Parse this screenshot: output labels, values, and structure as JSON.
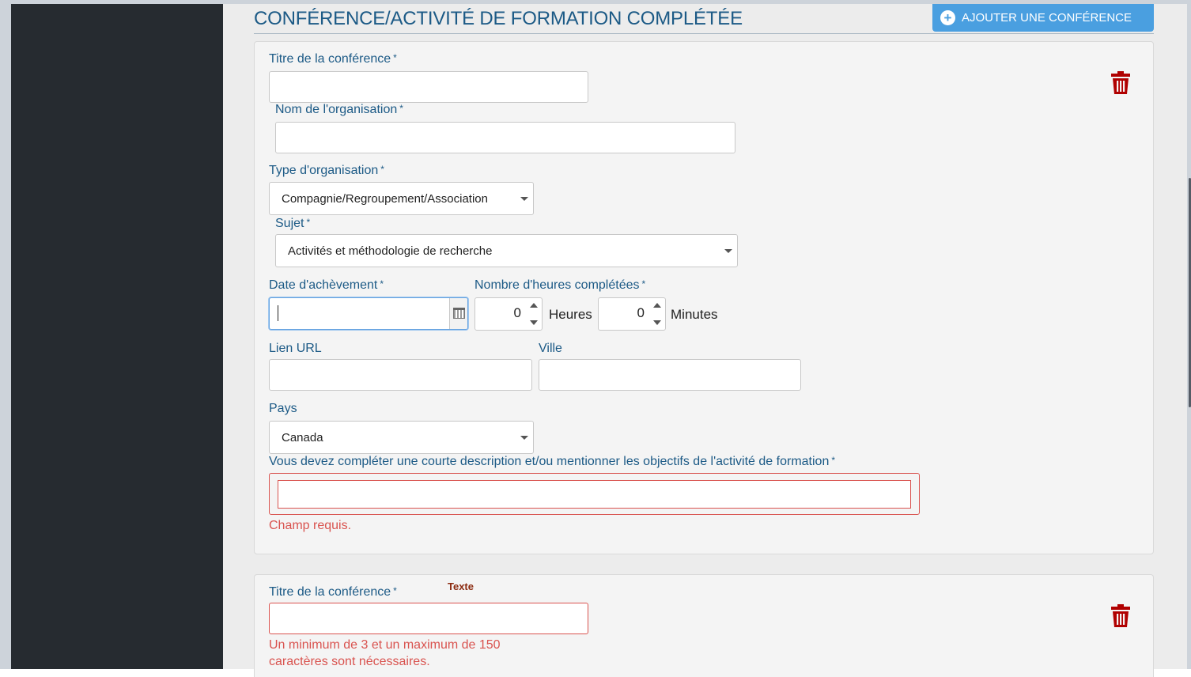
{
  "header": {
    "section_title": "CONFÉRENCE/ACTIVITÉ DE FORMATION COMPLÉTÉE",
    "add_button_label": "AJOUTER UNE CONFÉRENCE",
    "add_icon": "plus-circle-icon"
  },
  "colors": {
    "label_blue": "#1c5a86",
    "button_blue": "#4a9fe0",
    "sidebar": "#262b30",
    "error_red": "#d9534f",
    "trash_red": "#b00000"
  },
  "required_mark": "*",
  "form1": {
    "conference_title_label": "Titre de la conférence",
    "conference_title_value": "",
    "organization_name_label": "Nom de l'organisation",
    "organization_name_value": "",
    "organization_type_label": "Type d'organisation",
    "organization_type_value": "Compagnie/Regroupement/Association",
    "subject_label": "Sujet",
    "subject_value": "Activités et méthodologie de recherche",
    "completion_date_label": "Date d'achèvement",
    "completion_date_value": "",
    "hours_completed_label": "Nombre d'heures complétées",
    "hours_value": "0",
    "hours_unit": "Heures",
    "minutes_value": "0",
    "minutes_unit": "Minutes",
    "url_label": "Lien URL",
    "url_value": "",
    "city_label": "Ville",
    "city_value": "",
    "country_label": "Pays",
    "country_value": "Canada",
    "description_label": "Vous devez compléter une courte description et/ou mentionner les objectifs de l'activité de formation",
    "description_value": "",
    "description_error": "Champ requis.",
    "delete_icon": "trash-icon"
  },
  "form2": {
    "conference_title_label": "Titre de la conférence",
    "conference_title_value": "",
    "tooltip": "Texte",
    "title_error_line1": "Un minimum de 3 et un maximum de 150",
    "title_error_line2": "caractères sont nécessaires.",
    "delete_icon": "trash-icon"
  }
}
